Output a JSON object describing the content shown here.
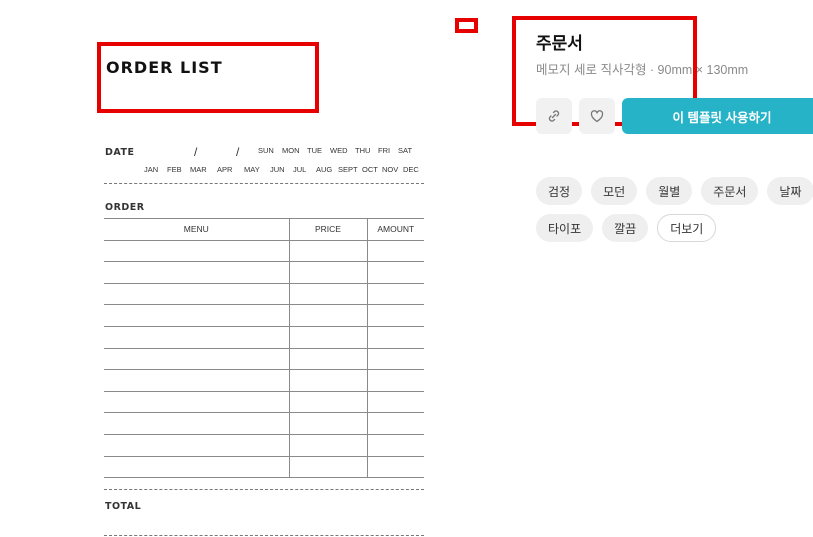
{
  "preview": {
    "title": "ORDER LIST",
    "date_label": "DATE",
    "date_separator": "/",
    "weekdays": [
      "SUN",
      "MON",
      "TUE",
      "WED",
      "THU",
      "FRI",
      "SAT"
    ],
    "months": [
      "JAN",
      "FEB",
      "MAR",
      "APR",
      "MAY",
      "JUN",
      "JUL",
      "AUG",
      "SEPT",
      "OCT",
      "NOV",
      "DEC"
    ],
    "order_label": "ORDER",
    "columns": [
      "MENU",
      "PRICE",
      "AMOUNT"
    ],
    "row_count": 11,
    "total_label": "TOTAL"
  },
  "info": {
    "title": "주문서",
    "subtitle": "메모지 세로 직사각형 · 90mm × 130mm",
    "link_icon": "link-icon",
    "like_icon": "heart-icon",
    "use_button_label": "이 템플릿 사용하기",
    "use_button_color": "#26b3c7"
  },
  "tags": {
    "row1": [
      "검정",
      "모던",
      "월별",
      "주문서",
      "날짜"
    ],
    "row2": [
      "타이포",
      "깔끔"
    ],
    "more_label": "더보기"
  },
  "annotation_color": "#e60000"
}
